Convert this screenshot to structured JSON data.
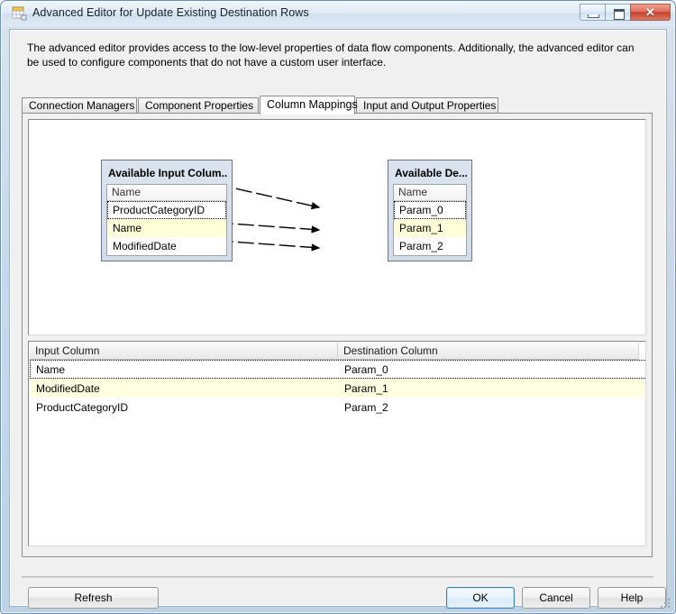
{
  "window": {
    "title": "Advanced Editor for Update Existing Destination Rows",
    "icon": "table-editor-icon",
    "minimize_label": "",
    "maximize_label": "",
    "close_label": "✕"
  },
  "description": "The advanced editor provides access to the low-level properties of data flow components. Additionally, the advanced editor can be used to configure components that do not have a custom user interface.",
  "tabs": [
    {
      "label": "Connection Managers",
      "selected": false
    },
    {
      "label": "Component Properties",
      "selected": false
    },
    {
      "label": "Column Mappings",
      "selected": true
    },
    {
      "label": "Input and Output Properties",
      "selected": false
    }
  ],
  "mapping_canvas": {
    "input_table": {
      "title": "Available Input Colum...",
      "column_header": "Name",
      "rows": [
        {
          "label": "ProductCategoryID",
          "state": "focus"
        },
        {
          "label": "Name",
          "state": "highlight"
        },
        {
          "label": "ModifiedDate",
          "state": "normal"
        }
      ]
    },
    "destination_table": {
      "title": "Available De...",
      "column_header": "Name",
      "rows": [
        {
          "label": "Param_0",
          "state": "focus"
        },
        {
          "label": "Param_1",
          "state": "highlight"
        },
        {
          "label": "Param_2",
          "state": "normal"
        }
      ]
    },
    "connections": [
      {
        "from": "Name",
        "to": "Param_0"
      },
      {
        "from": "ModifiedDate",
        "to": "Param_1"
      },
      {
        "from": "ProductCategoryID",
        "to": "Param_2"
      }
    ]
  },
  "grid": {
    "columns": [
      "Input Column",
      "Destination Column"
    ],
    "rows": [
      {
        "input": "Name",
        "destination": "Param_0",
        "state": "focus"
      },
      {
        "input": "ModifiedDate",
        "destination": "Param_1",
        "state": "highlight"
      },
      {
        "input": "ProductCategoryID",
        "destination": "Param_2",
        "state": "normal"
      }
    ]
  },
  "buttons": {
    "refresh": "Refresh",
    "ok": "OK",
    "cancel": "Cancel",
    "help": "Help"
  },
  "colors": {
    "highlight_row": "#ffffe1",
    "default_button_border": "#3c7fb1",
    "close_button": "#c7422f"
  }
}
